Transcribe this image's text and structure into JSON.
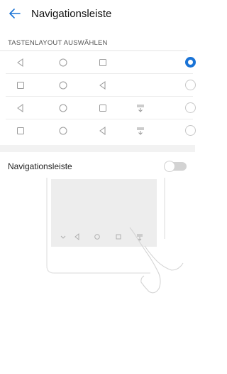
{
  "header": {
    "title": "Navigationsleiste"
  },
  "layout_section": {
    "heading": "TASTENLAYOUT AUSWÄHLEN",
    "options": [
      {
        "icons": [
          "back-icon",
          "home-icon",
          "recents-icon"
        ],
        "selected": true
      },
      {
        "icons": [
          "recents-icon",
          "home-icon",
          "back-icon"
        ],
        "selected": false
      },
      {
        "icons": [
          "back-icon",
          "home-icon",
          "recents-icon",
          "notification-pull-icon"
        ],
        "selected": false
      },
      {
        "icons": [
          "recents-icon",
          "home-icon",
          "back-icon",
          "notification-pull-icon"
        ],
        "selected": false
      }
    ]
  },
  "toggle": {
    "label": "Navigationsleiste",
    "state": "off"
  },
  "colors": {
    "accent": "#1a73d6",
    "divider": "#f2f2f2"
  }
}
